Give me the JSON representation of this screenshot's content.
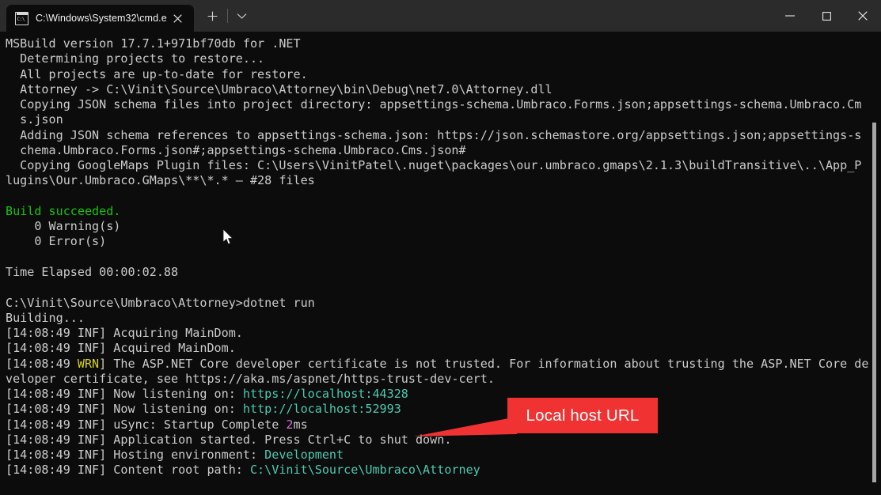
{
  "window": {
    "tab": {
      "title": "C:\\Windows\\System32\\cmd.e",
      "icon": "cmd-console-icon",
      "icon_prompt": "C:\\",
      "close_label": "×"
    },
    "new_tab_label": "+",
    "dropdown_label": "⌄",
    "controls": {
      "minimize": "–",
      "maximize": "□",
      "close": "×"
    }
  },
  "colors": {
    "background": "#0c0c0c",
    "titlebar": "#2b2b2b",
    "foreground": "#cccccc",
    "green": "#16c60c",
    "yellow": "#d8d21c",
    "cyan": "#4ec9b0",
    "magenta": "#d670d6",
    "annotation_red": "#f03232",
    "scrollbar": "#a6a6a6"
  },
  "annotation": {
    "label": "Local host URL",
    "target": "http://localhost:52993"
  },
  "terminal": {
    "lines": [
      [
        {
          "t": "MSBuild version 17.7.1+971bf70db for .NET",
          "c": "white"
        }
      ],
      [
        {
          "t": "  Determining projects to restore...",
          "c": "white"
        }
      ],
      [
        {
          "t": "  All projects are up-to-date for restore.",
          "c": "white"
        }
      ],
      [
        {
          "t": "  Attorney -> C:\\Vinit\\Source\\Umbraco\\Attorney\\bin\\Debug\\net7.0\\Attorney.dll",
          "c": "white"
        }
      ],
      [
        {
          "t": "  Copying JSON schema files into project directory: appsettings-schema.Umbraco.Forms.json;appsettings-schema.Umbraco.Cm",
          "c": "white"
        }
      ],
      [
        {
          "t": "  s.json",
          "c": "white"
        }
      ],
      [
        {
          "t": "  Adding JSON schema references to appsettings-schema.json: https://json.schemastore.org/appsettings.json;appsettings-s",
          "c": "white"
        }
      ],
      [
        {
          "t": "  chema.Umbraco.Forms.json#;appsettings-schema.Umbraco.Cms.json#",
          "c": "white"
        }
      ],
      [
        {
          "t": "  Copying GoogleMaps Plugin files: C:\\Users\\VinitPatel\\.nuget\\packages\\our.umbraco.gmaps\\2.1.3\\buildTransitive\\..\\App_P",
          "c": "white"
        }
      ],
      [
        {
          "t": "lugins\\Our.Umbraco.GMaps\\**\\*.* – #28 files",
          "c": "white"
        }
      ],
      [
        {
          "t": "",
          "c": "white"
        }
      ],
      [
        {
          "t": "Build succeeded.",
          "c": "green"
        }
      ],
      [
        {
          "t": "    0 Warning(s)",
          "c": "white"
        }
      ],
      [
        {
          "t": "    0 Error(s)",
          "c": "white"
        }
      ],
      [
        {
          "t": "",
          "c": "white"
        }
      ],
      [
        {
          "t": "Time Elapsed 00:00:02.88",
          "c": "white"
        }
      ],
      [
        {
          "t": "",
          "c": "white"
        }
      ],
      [
        {
          "t": "C:\\Vinit\\Source\\Umbraco\\Attorney>dotnet run",
          "c": "white"
        }
      ],
      [
        {
          "t": "Building...",
          "c": "white"
        }
      ],
      [
        {
          "t": "[14:08:49 INF] Acquiring MainDom.",
          "c": "white"
        }
      ],
      [
        {
          "t": "[14:08:49 INF] Acquired MainDom.",
          "c": "white"
        }
      ],
      [
        {
          "t": "[14:08:49 ",
          "c": "white"
        },
        {
          "t": "WRN",
          "c": "yellow"
        },
        {
          "t": "] The ASP.NET Core developer certificate is not trusted. For information about trusting the ASP.NET Core de",
          "c": "white"
        }
      ],
      [
        {
          "t": "veloper certificate, see https://aka.ms/aspnet/https-trust-dev-cert.",
          "c": "white"
        }
      ],
      [
        {
          "t": "[14:08:49 INF] Now listening on: ",
          "c": "white"
        },
        {
          "t": "https://localhost:44328",
          "c": "cyan"
        }
      ],
      [
        {
          "t": "[14:08:49 INF] Now listening on: ",
          "c": "white"
        },
        {
          "t": "http://localhost:52993",
          "c": "cyan"
        }
      ],
      [
        {
          "t": "[14:08:49 INF] uSync: Startup Complete ",
          "c": "white"
        },
        {
          "t": "2",
          "c": "magenta"
        },
        {
          "t": "ms",
          "c": "white"
        }
      ],
      [
        {
          "t": "[14:08:49 INF] Application started. Press Ctrl+C to shut down.",
          "c": "white"
        }
      ],
      [
        {
          "t": "[14:08:49 INF] Hosting environment: ",
          "c": "white"
        },
        {
          "t": "Development",
          "c": "cyan"
        }
      ],
      [
        {
          "t": "[14:08:49 INF] Content root path: ",
          "c": "white"
        },
        {
          "t": "C:\\Vinit\\Source\\Umbraco\\Attorney",
          "c": "cyan"
        }
      ]
    ]
  }
}
